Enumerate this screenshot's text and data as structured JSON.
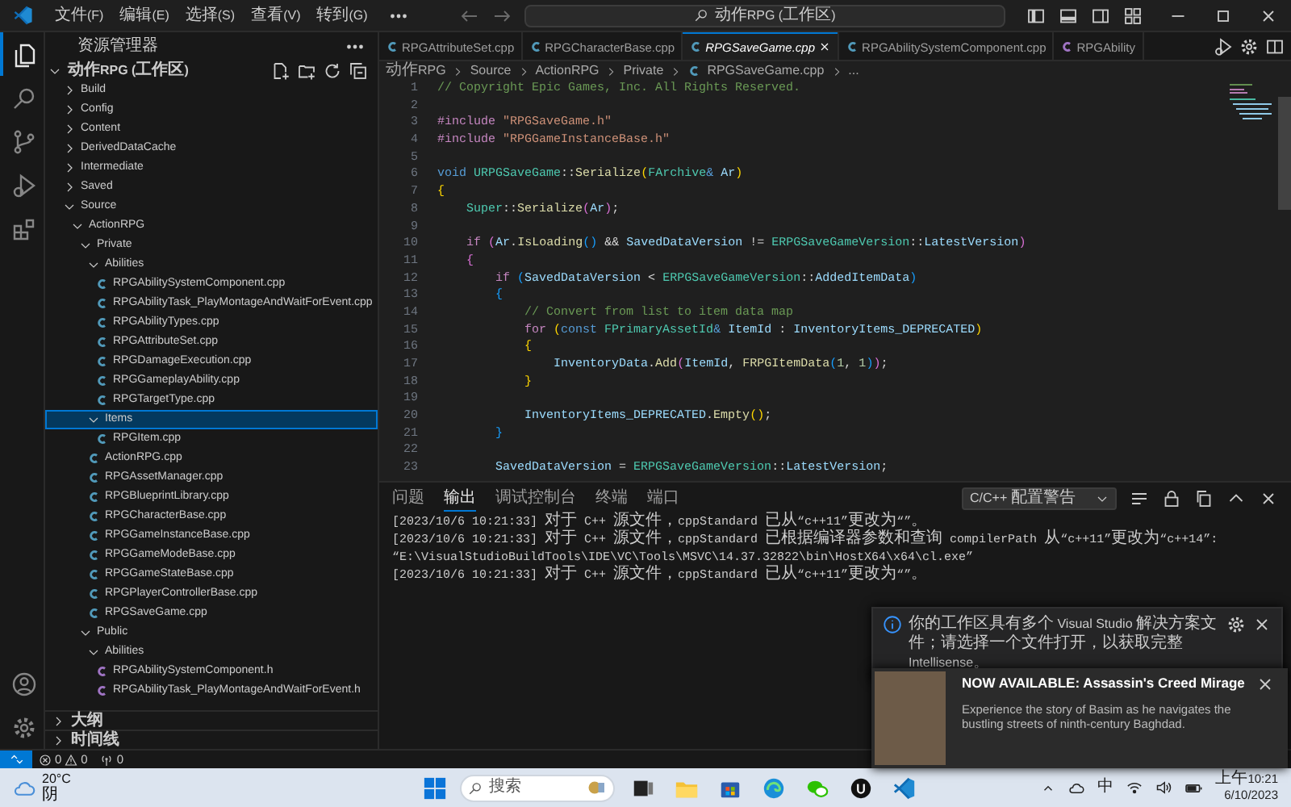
{
  "title_bar": {
    "menus": [
      "文件(F)",
      "编辑(E)",
      "选择(S)",
      "查看(V)",
      "转到(G)"
    ],
    "search": "动作RPG (工作区)"
  },
  "activity_bar": {
    "items": [
      {
        "kind": "files",
        "selected": true
      },
      {
        "kind": "search",
        "selected": false
      },
      {
        "kind": "scm",
        "selected": false
      },
      {
        "kind": "run",
        "selected": false
      },
      {
        "kind": "extensions",
        "selected": false
      }
    ],
    "bottom": [
      {
        "kind": "account"
      },
      {
        "kind": "settings"
      }
    ]
  },
  "sidebar": {
    "title": "资源管理器",
    "workspace": {
      "label": "动作RPG (工作区)",
      "expanded": true
    },
    "tree": [
      {
        "label": "Build",
        "kind": "folder",
        "expanded": false,
        "selected": false
      },
      {
        "label": "Config",
        "kind": "folder",
        "expanded": false,
        "selected": false
      },
      {
        "label": "Content",
        "kind": "folder",
        "expanded": false,
        "selected": false
      },
      {
        "label": "DerivedDataCache",
        "kind": "folder",
        "expanded": false,
        "selected": false
      },
      {
        "label": "Intermediate",
        "kind": "folder",
        "expanded": false,
        "selected": false
      },
      {
        "label": "Saved",
        "kind": "folder",
        "expanded": false,
        "selected": false
      },
      {
        "label": "Source",
        "kind": "folder",
        "expanded": true,
        "selected": false,
        "children": [
          {
            "label": "ActionRPG",
            "kind": "folder",
            "expanded": true,
            "selected": false,
            "children": [
              {
                "label": "Private",
                "kind": "folder",
                "expanded": true,
                "selected": false,
                "children": [
                  {
                    "label": "Abilities",
                    "kind": "folder",
                    "expanded": true,
                    "selected": false,
                    "children": [
                      {
                        "label": "RPGAbilitySystemComponent.cpp",
                        "kind": "cpp",
                        "selected": false
                      },
                      {
                        "label": "RPGAbilityTask_PlayMontageAndWaitForEvent.cpp",
                        "kind": "cpp",
                        "selected": false
                      },
                      {
                        "label": "RPGAbilityTypes.cpp",
                        "kind": "cpp",
                        "selected": false
                      },
                      {
                        "label": "RPGAttributeSet.cpp",
                        "kind": "cpp",
                        "selected": false
                      },
                      {
                        "label": "RPGDamageExecution.cpp",
                        "kind": "cpp",
                        "selected": false
                      },
                      {
                        "label": "RPGGameplayAbility.cpp",
                        "kind": "cpp",
                        "selected": false
                      },
                      {
                        "label": "RPGTargetType.cpp",
                        "kind": "cpp",
                        "selected": false
                      }
                    ]
                  },
                  {
                    "label": "Items",
                    "kind": "folder",
                    "expanded": true,
                    "selected": true,
                    "children": [
                      {
                        "label": "RPGItem.cpp",
                        "kind": "cpp",
                        "selected": false
                      }
                    ]
                  },
                  {
                    "label": "ActionRPG.cpp",
                    "kind": "cpp",
                    "selected": false
                  },
                  {
                    "label": "RPGAssetManager.cpp",
                    "kind": "cpp",
                    "selected": false
                  },
                  {
                    "label": "RPGBlueprintLibrary.cpp",
                    "kind": "cpp",
                    "selected": false
                  },
                  {
                    "label": "RPGCharacterBase.cpp",
                    "kind": "cpp",
                    "selected": false
                  },
                  {
                    "label": "RPGGameInstanceBase.cpp",
                    "kind": "cpp",
                    "selected": false
                  },
                  {
                    "label": "RPGGameModeBase.cpp",
                    "kind": "cpp",
                    "selected": false
                  },
                  {
                    "label": "RPGGameStateBase.cpp",
                    "kind": "cpp",
                    "selected": false
                  },
                  {
                    "label": "RPGPlayerControllerBase.cpp",
                    "kind": "cpp",
                    "selected": false
                  },
                  {
                    "label": "RPGSaveGame.cpp",
                    "kind": "cpp",
                    "selected": false
                  }
                ]
              },
              {
                "label": "Public",
                "kind": "folder",
                "expanded": true,
                "selected": false,
                "children": [
                  {
                    "label": "Abilities",
                    "kind": "folder",
                    "expanded": true,
                    "selected": false,
                    "children": [
                      {
                        "label": "RPGAbilitySystemComponent.h",
                        "kind": "h",
                        "selected": false
                      },
                      {
                        "label": "RPGAbilityTask_PlayMontageAndWaitForEvent.h",
                        "kind": "h",
                        "selected": false
                      }
                    ]
                  }
                ]
              }
            ]
          }
        ]
      }
    ],
    "sections": [
      {
        "label": "大纲",
        "expanded": false
      },
      {
        "label": "时间线",
        "expanded": false
      }
    ]
  },
  "tabs": [
    {
      "label": "RPGAttributeSet.cpp",
      "kind": "cpp",
      "selected": false
    },
    {
      "label": "RPGCharacterBase.cpp",
      "kind": "cpp",
      "selected": false
    },
    {
      "label": "RPGSaveGame.cpp",
      "kind": "cpp",
      "selected": true
    },
    {
      "label": "RPGAbilitySystemComponent.cpp",
      "kind": "cpp",
      "selected": false
    },
    {
      "label": "RPGAbility",
      "kind": "h",
      "selected": false
    }
  ],
  "breadcrumb": [
    {
      "label": "动作RPG",
      "kind": "folder"
    },
    {
      "label": "Source",
      "kind": "folder"
    },
    {
      "label": "ActionRPG",
      "kind": "folder"
    },
    {
      "label": "Private",
      "kind": "folder"
    },
    {
      "label": "RPGSaveGame.cpp",
      "kind": "cpp"
    },
    {
      "label": "...",
      "kind": "symbol"
    }
  ],
  "editor": {
    "lines": [
      {
        "number": "1",
        "tokens": [
          {
            "kind": "comment",
            "text": "// Copyright Epic Games, Inc. All Rights Reserved."
          }
        ]
      },
      {
        "number": "2"
      },
      {
        "number": "3",
        "tokens": [
          {
            "kind": "macro",
            "text": "#include"
          },
          {
            "kind": "string",
            "text": " \"RPGSaveGame.h\""
          }
        ]
      },
      {
        "number": "4",
        "tokens": [
          {
            "kind": "macro",
            "text": "#include"
          },
          {
            "kind": "string",
            "text": " \"RPGGameInstanceBase.h\""
          }
        ]
      },
      {
        "number": "5"
      },
      {
        "number": "6",
        "tokens": [
          {
            "kind": "keyword",
            "text": "void"
          },
          {
            "kind": "type",
            "text": " URPGSaveGame"
          },
          {
            "kind": "plain",
            "text": "::"
          },
          {
            "kind": "function",
            "text": "Serialize"
          },
          {
            "kind": "brace1",
            "text": "("
          },
          {
            "kind": "type",
            "text": "FArchive"
          },
          {
            "kind": "keyword",
            "text": "&"
          },
          {
            "kind": "variable",
            "text": " Ar"
          },
          {
            "kind": "brace1",
            "text": ")"
          }
        ]
      },
      {
        "number": "7",
        "tokens": [
          {
            "kind": "brace1",
            "text": "{"
          }
        ]
      },
      {
        "number": "8",
        "tokens": [
          {
            "kind": "type",
            "text": "    Super"
          },
          {
            "kind": "plain",
            "text": "::"
          },
          {
            "kind": "function",
            "text": "Serialize"
          },
          {
            "kind": "brace2",
            "text": "("
          },
          {
            "kind": "variable",
            "text": "Ar"
          },
          {
            "kind": "brace2",
            "text": ")"
          },
          {
            "kind": "plain",
            "text": ";"
          }
        ]
      },
      {
        "number": "9"
      },
      {
        "number": "10",
        "tokens": [
          {
            "kind": "control",
            "text": "    if"
          },
          {
            "kind": "brace2",
            "text": " ("
          },
          {
            "kind": "variable",
            "text": "Ar"
          },
          {
            "kind": "plain",
            "text": "."
          },
          {
            "kind": "function",
            "text": "IsLoading"
          },
          {
            "kind": "brace3",
            "text": "()"
          },
          {
            "kind": "plain",
            "text": " && "
          },
          {
            "kind": "variable",
            "text": "SavedDataVersion"
          },
          {
            "kind": "plain",
            "text": " != "
          },
          {
            "kind": "type",
            "text": "ERPGSaveGameVersion"
          },
          {
            "kind": "plain",
            "text": "::"
          },
          {
            "kind": "variable",
            "text": "LatestVersion"
          },
          {
            "kind": "brace2",
            "text": ")"
          }
        ]
      },
      {
        "number": "11",
        "tokens": [
          {
            "kind": "brace2",
            "text": "    {"
          }
        ]
      },
      {
        "number": "12",
        "tokens": [
          {
            "kind": "control",
            "text": "        if"
          },
          {
            "kind": "brace3",
            "text": " ("
          },
          {
            "kind": "variable",
            "text": "SavedDataVersion"
          },
          {
            "kind": "plain",
            "text": " < "
          },
          {
            "kind": "type",
            "text": "ERPGSaveGameVersion"
          },
          {
            "kind": "plain",
            "text": "::"
          },
          {
            "kind": "variable",
            "text": "AddedItemData"
          },
          {
            "kind": "brace3",
            "text": ")"
          }
        ]
      },
      {
        "number": "13",
        "tokens": [
          {
            "kind": "brace3",
            "text": "        {"
          }
        ]
      },
      {
        "number": "14",
        "tokens": [
          {
            "kind": "comment",
            "text": "            // Convert from list to item data map"
          }
        ]
      },
      {
        "number": "15",
        "tokens": [
          {
            "kind": "control",
            "text": "            for"
          },
          {
            "kind": "brace1",
            "text": " ("
          },
          {
            "kind": "keyword",
            "text": "const"
          },
          {
            "kind": "type",
            "text": " FPrimaryAssetId"
          },
          {
            "kind": "keyword",
            "text": "&"
          },
          {
            "kind": "variable",
            "text": " ItemId"
          },
          {
            "kind": "plain",
            "text": " : "
          },
          {
            "kind": "variable",
            "text": "InventoryItems_DEPRECATED"
          },
          {
            "kind": "brace1",
            "text": ")"
          }
        ]
      },
      {
        "number": "16",
        "tokens": [
          {
            "kind": "brace1",
            "text": "            {"
          }
        ]
      },
      {
        "number": "17",
        "tokens": [
          {
            "kind": "variable",
            "text": "                InventoryData"
          },
          {
            "kind": "plain",
            "text": "."
          },
          {
            "kind": "function",
            "text": "Add"
          },
          {
            "kind": "brace2",
            "text": "("
          },
          {
            "kind": "variable",
            "text": "ItemId"
          },
          {
            "kind": "plain",
            "text": ", "
          },
          {
            "kind": "function",
            "text": "FRPGItemData"
          },
          {
            "kind": "brace3",
            "text": "("
          },
          {
            "kind": "number",
            "text": "1"
          },
          {
            "kind": "plain",
            "text": ", "
          },
          {
            "kind": "number",
            "text": "1"
          },
          {
            "kind": "brace3",
            "text": ")"
          },
          {
            "kind": "brace2",
            "text": ")"
          },
          {
            "kind": "plain",
            "text": ";"
          }
        ]
      },
      {
        "number": "18",
        "tokens": [
          {
            "kind": "brace1",
            "text": "            }"
          }
        ]
      },
      {
        "number": "19"
      },
      {
        "number": "20",
        "tokens": [
          {
            "kind": "variable",
            "text": "            InventoryItems_DEPRECATED"
          },
          {
            "kind": "plain",
            "text": "."
          },
          {
            "kind": "function",
            "text": "Empty"
          },
          {
            "kind": "brace1",
            "text": "()"
          },
          {
            "kind": "plain",
            "text": ";"
          }
        ]
      },
      {
        "number": "21",
        "tokens": [
          {
            "kind": "brace3",
            "text": "        }"
          }
        ]
      },
      {
        "number": "22"
      },
      {
        "number": "23",
        "tokens": [
          {
            "kind": "variable",
            "text": "        SavedDataVersion"
          },
          {
            "kind": "plain",
            "text": " = "
          },
          {
            "kind": "type",
            "text": "ERPGSaveGameVersion"
          },
          {
            "kind": "plain",
            "text": "::"
          },
          {
            "kind": "variable",
            "text": "LatestVersion"
          },
          {
            "kind": "plain",
            "text": ";"
          }
        ]
      }
    ]
  },
  "panel": {
    "tabs": [
      {
        "label": "问题",
        "selected": false
      },
      {
        "label": "输出",
        "selected": true
      },
      {
        "label": "调试控制台",
        "selected": false
      },
      {
        "label": "终端",
        "selected": false
      },
      {
        "label": "端口",
        "selected": false
      }
    ],
    "channel": "C/C++ 配置警告",
    "output": [
      "[2023/10/6 10:21:33] 对于 C++ 源文件，cppStandard 已从“c++11”更改为“”。",
      "[2023/10/6 10:21:33] 对于 C++ 源文件，cppStandard 已根据编译器参数和查询 compilerPath 从“c++11”更改为“c++14”:",
      "“E:\\VisualStudioBuildTools\\IDE\\VC\\Tools\\MSVC\\14.37.32822\\bin\\HostX64\\x64\\cl.exe”",
      "[2023/10/6 10:21:33] 对于 C++ 源文件，cppStandard 已从“c++11”更改为“”。"
    ]
  },
  "notification": {
    "kind": "info",
    "message": "你的工作区具有多个 Visual Studio 解决方案文件；请选择一个文件打开，以获取完整 Intellisense。"
  },
  "toast": {
    "title": "NOW AVAILABLE: Assassin's Creed Mirage",
    "body": "Experience the story of Basim as he navigates the bustling streets of ninth-century Baghdad."
  },
  "status_bar": {
    "errors": "0",
    "warnings": "0",
    "ports": "0"
  },
  "taskbar": {
    "temperature": "20°C",
    "condition": "阴",
    "search": "搜索",
    "ime": "中",
    "time": "上午10:21",
    "date": "6/10/2023"
  }
}
